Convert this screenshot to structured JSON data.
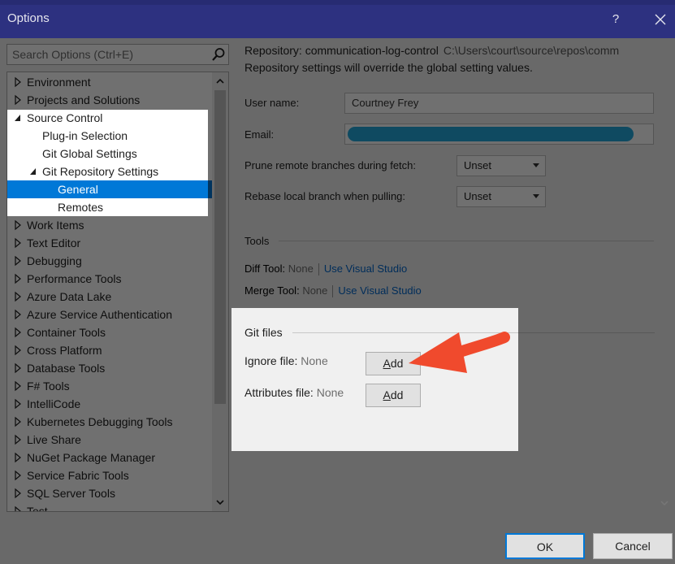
{
  "window": {
    "title": "Options",
    "help": "?"
  },
  "search": {
    "placeholder": "Search Options (Ctrl+E)",
    "value": ""
  },
  "tree": {
    "items": [
      {
        "label": "Environment",
        "level": 0,
        "expander": "collapsed"
      },
      {
        "label": "Projects and Solutions",
        "level": 0,
        "expander": "collapsed"
      },
      {
        "label": "Source Control",
        "level": 0,
        "expander": "expanded"
      },
      {
        "label": "Plug-in Selection",
        "level": 1,
        "expander": "none"
      },
      {
        "label": "Git Global Settings",
        "level": 1,
        "expander": "none"
      },
      {
        "label": "Git Repository Settings",
        "level": 1,
        "expander": "expanded"
      },
      {
        "label": "General",
        "level": 2,
        "expander": "none",
        "selected": true
      },
      {
        "label": "Remotes",
        "level": 2,
        "expander": "none"
      },
      {
        "label": "Work Items",
        "level": 0,
        "expander": "collapsed"
      },
      {
        "label": "Text Editor",
        "level": 0,
        "expander": "collapsed"
      },
      {
        "label": "Debugging",
        "level": 0,
        "expander": "collapsed"
      },
      {
        "label": "Performance Tools",
        "level": 0,
        "expander": "collapsed"
      },
      {
        "label": "Azure Data Lake",
        "level": 0,
        "expander": "collapsed"
      },
      {
        "label": "Azure Service Authentication",
        "level": 0,
        "expander": "collapsed"
      },
      {
        "label": "Container Tools",
        "level": 0,
        "expander": "collapsed"
      },
      {
        "label": "Cross Platform",
        "level": 0,
        "expander": "collapsed"
      },
      {
        "label": "Database Tools",
        "level": 0,
        "expander": "collapsed"
      },
      {
        "label": "F# Tools",
        "level": 0,
        "expander": "collapsed"
      },
      {
        "label": "IntelliCode",
        "level": 0,
        "expander": "collapsed"
      },
      {
        "label": "Kubernetes Debugging Tools",
        "level": 0,
        "expander": "collapsed"
      },
      {
        "label": "Live Share",
        "level": 0,
        "expander": "collapsed"
      },
      {
        "label": "NuGet Package Manager",
        "level": 0,
        "expander": "collapsed"
      },
      {
        "label": "Service Fabric Tools",
        "level": 0,
        "expander": "collapsed"
      },
      {
        "label": "SQL Server Tools",
        "level": 0,
        "expander": "collapsed"
      },
      {
        "label": "Test",
        "level": 0,
        "expander": "collapsed"
      }
    ]
  },
  "repo": {
    "label": "Repository: communication-log-control",
    "path": "C:\\Users\\court\\source\\repos\\comm",
    "note": "Repository settings will override the global setting values."
  },
  "form": {
    "user_name_label": "User name:",
    "user_name_value": "Courtney Frey",
    "email_label": "Email:",
    "prune_label": "Prune remote branches during fetch:",
    "prune_value": "Unset",
    "rebase_label": "Rebase local branch when pulling:",
    "rebase_value": "Unset"
  },
  "tools": {
    "title": "Tools",
    "diff_label": "Diff Tool:",
    "diff_value": "None",
    "diff_link": "Use Visual Studio",
    "merge_label": "Merge Tool:",
    "merge_value": "None",
    "merge_link": "Use Visual Studio"
  },
  "git_files": {
    "title": "Git files",
    "ignore_label": "Ignore file:",
    "ignore_value": "None",
    "ignore_button_hotkey": "A",
    "ignore_button_rest": "dd",
    "attributes_label": "Attributes file:",
    "attributes_value": "None",
    "attributes_button_hotkey": "A",
    "attributes_button_rest": "dd"
  },
  "footer": {
    "ok": "OK",
    "cancel": "Cancel"
  },
  "colors": {
    "title_bar": "#2d3180",
    "selection": "#0078d7",
    "email_redaction": "#23a9de",
    "annotation_arrow": "#f04a2d"
  }
}
